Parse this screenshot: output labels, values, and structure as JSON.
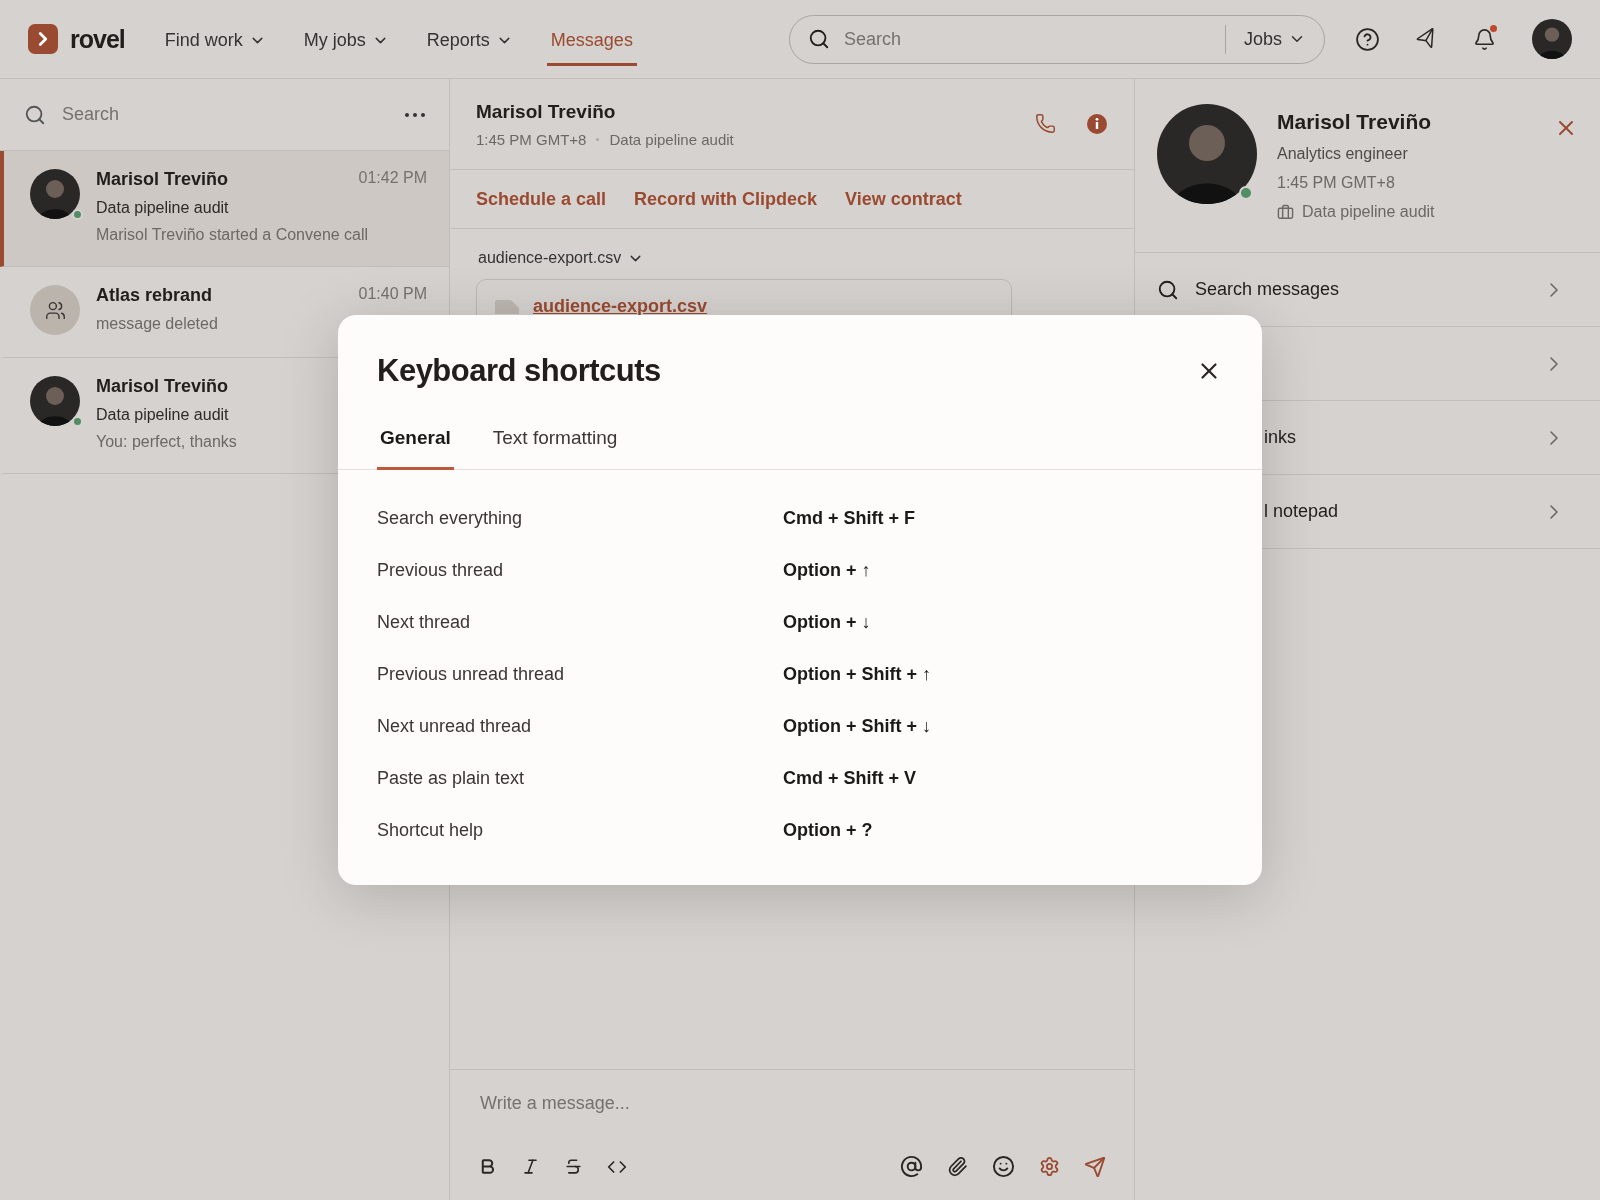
{
  "header": {
    "logo": "rovel",
    "nav": [
      {
        "label": "Find work",
        "dropdown": true,
        "selected": false
      },
      {
        "label": "My jobs",
        "dropdown": true,
        "selected": false
      },
      {
        "label": "Reports",
        "dropdown": true,
        "selected": false
      },
      {
        "label": "Messages",
        "dropdown": false,
        "selected": true
      }
    ],
    "search": {
      "placeholder": "Search",
      "scope": "Jobs"
    },
    "notifications_unread": true
  },
  "conversations": {
    "search_placeholder": "Search",
    "items": [
      {
        "name": "Marisol Treviño",
        "time": "01:42 PM",
        "title": "Data pipeline audit",
        "preview": "Marisol Treviño started a Convene call",
        "kind": "person",
        "online": true,
        "selected": true
      },
      {
        "name": "Atlas rebrand",
        "time": "01:40 PM",
        "preview": "message deleted",
        "kind": "group",
        "online": false,
        "selected": false
      },
      {
        "name": "Marisol Treviño",
        "title": "Data pipeline audit",
        "preview": "You: perfect, thanks",
        "kind": "person",
        "online": true,
        "selected": false
      }
    ]
  },
  "thread": {
    "name": "Marisol Treviño",
    "time": "1:45 PM GMT+8",
    "project": "Data pipeline audit",
    "actions": [
      "Schedule a call",
      "Record with Clipdeck",
      "View contract"
    ],
    "file_menu": "audience-export.csv",
    "file_name": "audience-export.csv",
    "composer": {
      "placeholder": "Write a message..."
    }
  },
  "profile": {
    "name": "Marisol Treviño",
    "role": "Analytics engineer",
    "time": "1:45 PM GMT+8",
    "project": "Data pipeline audit",
    "online": true,
    "rows": [
      {
        "kind": "search",
        "label": "Search messages"
      },
      {
        "kind": "plain"
      },
      {
        "kind": "plain",
        "label": "inks"
      },
      {
        "kind": "plain",
        "label": "l notepad"
      }
    ]
  },
  "dialog": {
    "title": "Keyboard shortcuts",
    "tabs": [
      {
        "label": "General",
        "selected": true
      },
      {
        "label": "Text formatting",
        "selected": false
      }
    ],
    "shortcuts": [
      {
        "action": "Search everything",
        "keys": "Cmd + Shift + F"
      },
      {
        "action": "Previous thread",
        "keys": "Option + ↑"
      },
      {
        "action": "Next thread",
        "keys": "Option + ↓"
      },
      {
        "action": "Previous unread thread",
        "keys": "Option + Shift + ↑"
      },
      {
        "action": "Next unread thread",
        "keys": "Option + Shift + ↓"
      },
      {
        "action": "Paste as plain text",
        "keys": "Cmd + Shift + V"
      },
      {
        "action": "Shortcut help",
        "keys": "Option + ?"
      }
    ]
  }
}
